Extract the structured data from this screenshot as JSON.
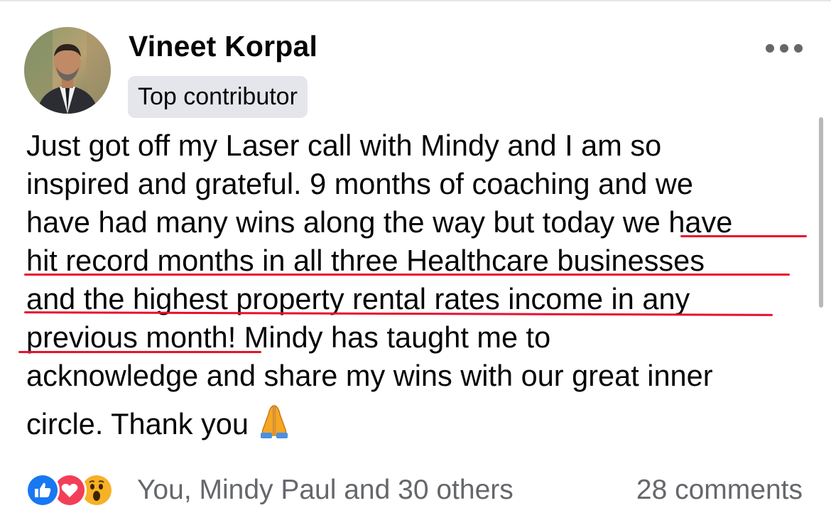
{
  "post": {
    "author": "Vineet Korpal",
    "badge": "Top contributor",
    "more_icon": "more-horizontal-icon",
    "text_lines": [
      "Just got off my Laser call with Mindy and I am so",
      "inspired and grateful. 9 months of coaching and we",
      "have had many wins along the way but today we have",
      "hit record months in all three Healthcare businesses",
      "and the highest property rental rates income in any",
      "previous month! Mindy has taught me to",
      "acknowledge and share my wins with our great inner",
      "circle. Thank you"
    ],
    "emoji": "folded-hands-emoji",
    "highlight_color": "#e8112d"
  },
  "footer": {
    "reaction_icons": [
      "like-reaction-icon",
      "love-reaction-icon",
      "wow-reaction-icon"
    ],
    "reactions_text": "You, Mindy Paul and 30 others",
    "comments_text": "28 comments"
  },
  "colors": {
    "badge_bg": "#e4e6eb",
    "secondary_text": "#65676b",
    "like_blue": "#1877f2",
    "love_red": "#f33e58",
    "wow_yellow": "#f7b125"
  }
}
